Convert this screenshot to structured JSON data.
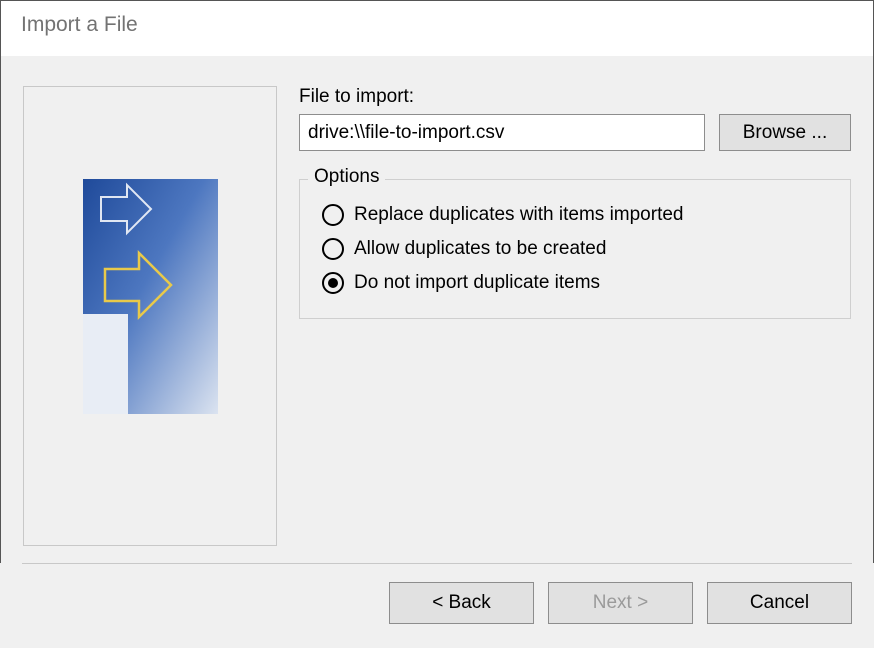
{
  "title": "Import a File",
  "file_section": {
    "label": "File to import:",
    "value": "drive:\\\\file-to-import.csv",
    "browse_label": "Browse ..."
  },
  "options": {
    "legend": "Options",
    "items": [
      {
        "label": "Replace duplicates with items imported",
        "selected": false
      },
      {
        "label": "Allow duplicates to be created",
        "selected": false
      },
      {
        "label": "Do not import duplicate items",
        "selected": true
      }
    ]
  },
  "buttons": {
    "back": "< Back",
    "next": "Next >",
    "cancel": "Cancel",
    "next_enabled": false
  }
}
